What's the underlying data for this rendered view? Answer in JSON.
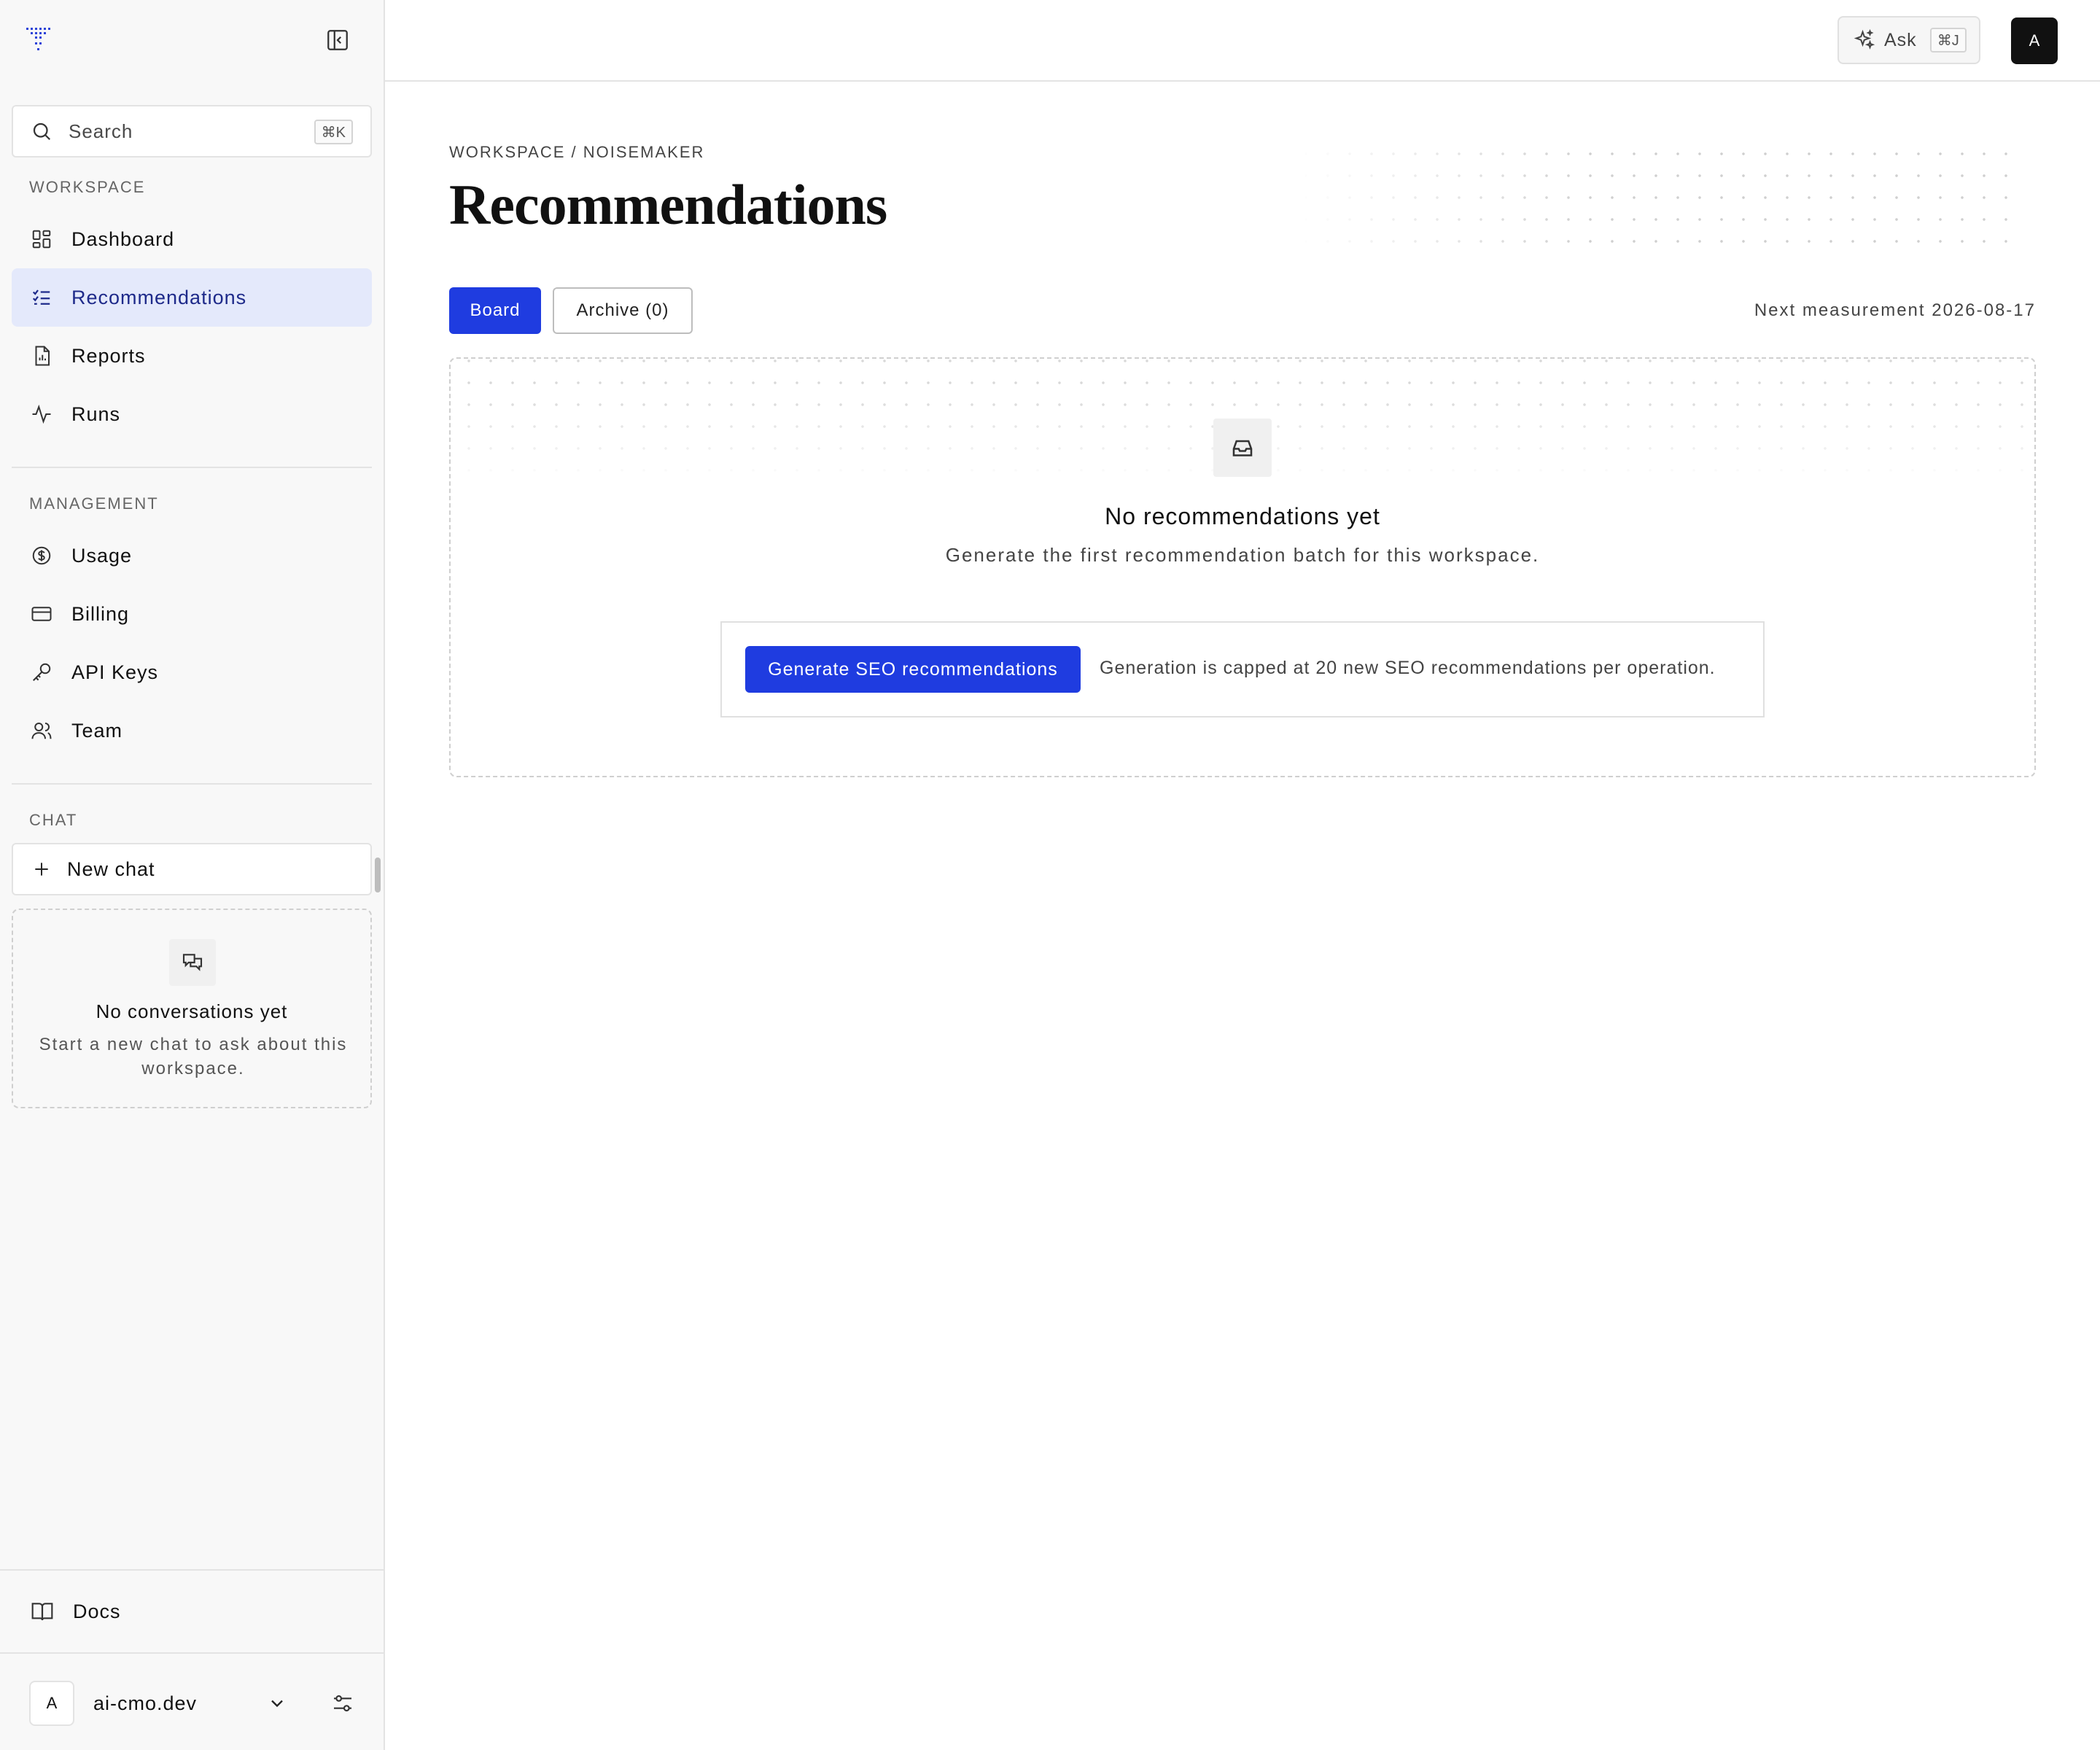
{
  "sidebar": {
    "search": {
      "label": "Search",
      "shortcut": "⌘K"
    },
    "sections": {
      "workspace": "WORKSPACE",
      "management": "MANAGEMENT",
      "chat": "CHAT"
    },
    "workspace_items": [
      {
        "label": "Dashboard",
        "icon": "dashboard-icon"
      },
      {
        "label": "Recommendations",
        "icon": "checklist-icon",
        "active": true
      },
      {
        "label": "Reports",
        "icon": "report-icon"
      },
      {
        "label": "Runs",
        "icon": "activity-icon"
      }
    ],
    "management_items": [
      {
        "label": "Usage",
        "icon": "dollar-icon"
      },
      {
        "label": "Billing",
        "icon": "card-icon"
      },
      {
        "label": "API Keys",
        "icon": "key-icon"
      },
      {
        "label": "Team",
        "icon": "users-icon"
      }
    ],
    "chat": {
      "new_chat": "New chat",
      "empty_title": "No conversations yet",
      "empty_text": "Start a new chat to ask about this workspace."
    },
    "docs": "Docs",
    "account": {
      "avatar": "A",
      "name": "ai-cmo.dev"
    }
  },
  "topbar": {
    "ask_label": "Ask",
    "ask_shortcut": "⌘J",
    "avatar": "A"
  },
  "main": {
    "breadcrumb": "WORKSPACE / NOISEMAKER",
    "title": "Recommendations",
    "tabs": [
      {
        "label": "Board",
        "active": true
      },
      {
        "label": "Archive (0)",
        "active": false
      }
    ],
    "next_measurement": "Next measurement 2026-08-17",
    "empty": {
      "title": "No recommendations yet",
      "subtitle": "Generate the first recommendation batch for this workspace.",
      "button": "Generate SEO recommendations",
      "note": "Generation is capped at 20 new SEO recommendations per operation."
    }
  },
  "colors": {
    "accent": "#1f3ce0",
    "active_nav_bg": "#e4e9fb",
    "sidebar_bg": "#f8f8f8"
  }
}
